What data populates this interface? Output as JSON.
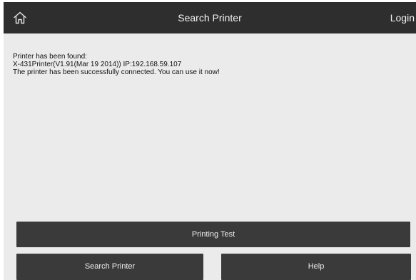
{
  "header": {
    "title": "Search Printer",
    "login_label": "Login",
    "home_icon": "home-icon"
  },
  "messages": {
    "line1": "Printer has been found:",
    "line2": "X-431Printer(V1.91(Mar 19 2014))  IP:192.168.59.107",
    "line3": "The printer has been successfully connected. You can use it now!"
  },
  "buttons": {
    "printing_test": "Printing Test",
    "search_printer": "Search Printer",
    "help": "Help"
  },
  "colors": {
    "topbar": "#2e2e2e",
    "content_bg": "#ebebeb",
    "button_bg": "#3a3a3a"
  }
}
